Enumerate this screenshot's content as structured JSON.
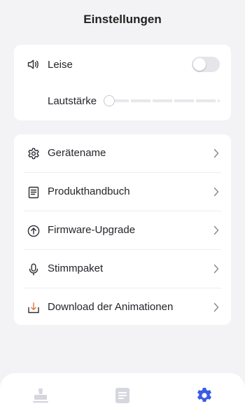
{
  "header": {
    "title": "Einstellungen"
  },
  "sound": {
    "mute_label": "Leise",
    "mute_on": false,
    "volume_label": "Lautstärke",
    "volume_value": 0
  },
  "menu": {
    "items": [
      {
        "label": "Gerätename",
        "icon": "gear-icon"
      },
      {
        "label": "Produkthandbuch",
        "icon": "document-icon"
      },
      {
        "label": "Firmware-Upgrade",
        "icon": "upload-circle-icon"
      },
      {
        "label": "Stimmpaket",
        "icon": "microphone-icon"
      },
      {
        "label": "Download der Animationen",
        "icon": "download-icon"
      }
    ]
  },
  "colors": {
    "accent": "#3a5be8",
    "inactive_tab": "#d6d6de"
  },
  "tabbar": {
    "active": "settings"
  }
}
